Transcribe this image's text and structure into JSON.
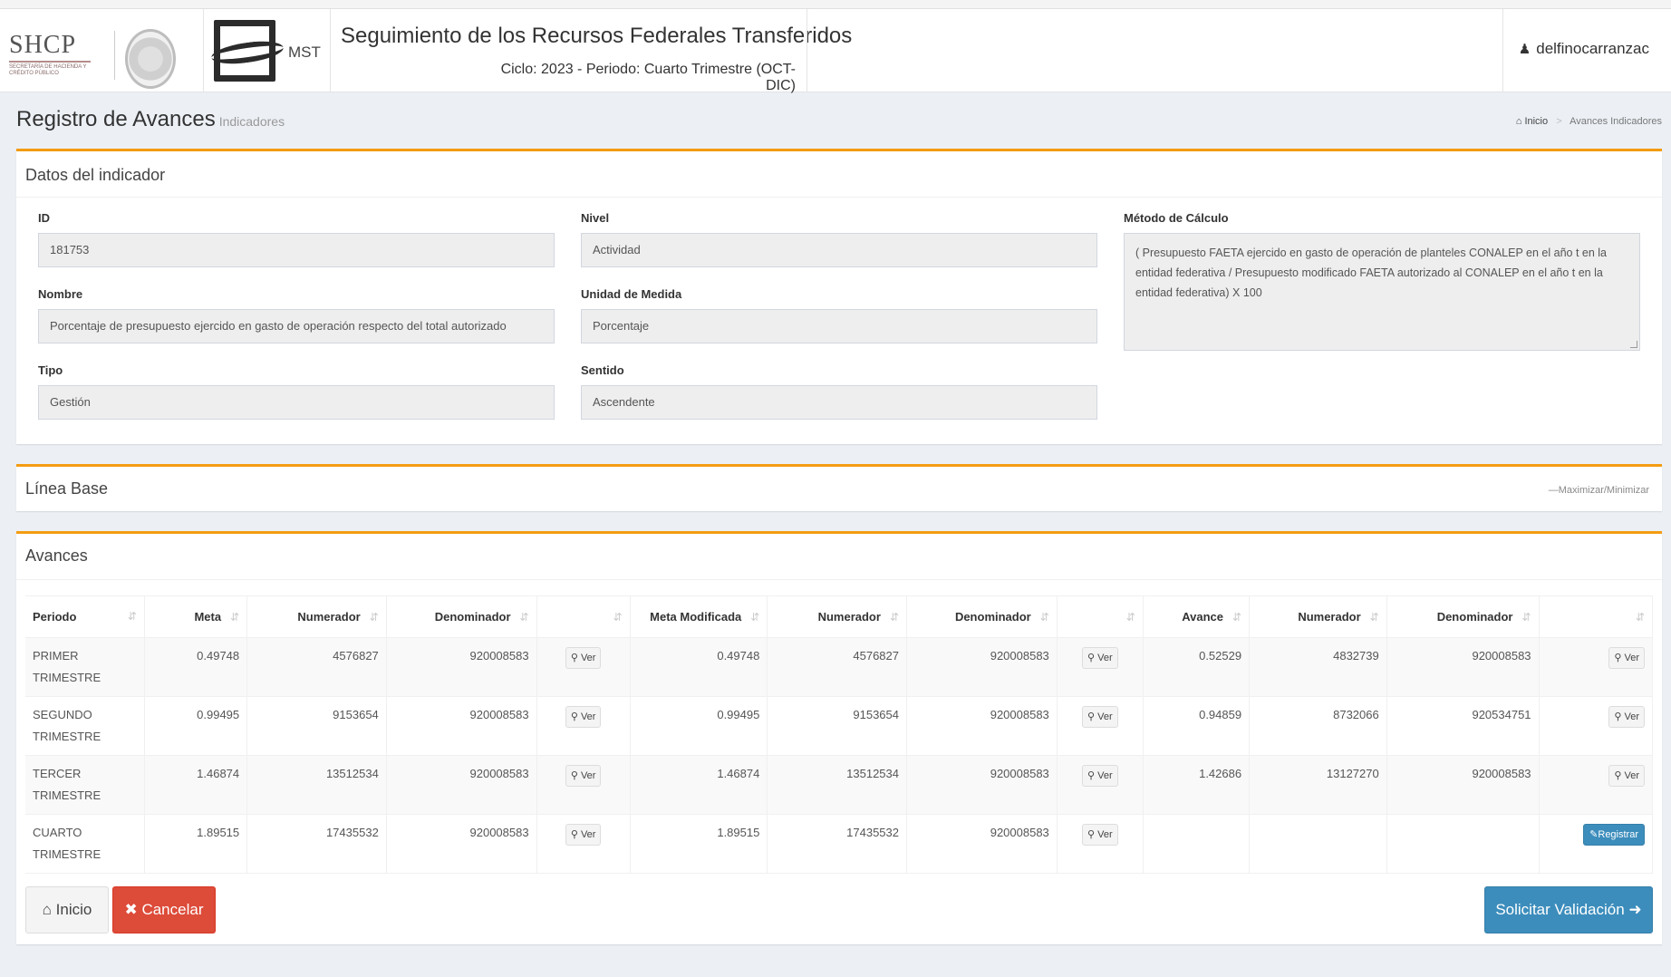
{
  "header": {
    "shcp_logo_text": "SHCP",
    "shcp_logo_sub": "SECRETARÍA DE HACIENDA Y CRÉDITO PÚBLICO",
    "mst_text": "MST",
    "title": "Seguimiento de los Recursos Federales Transferidos",
    "subtitle": "Ciclo: 2023 - Periodo: Cuarto Trimestre (OCT-DIC)",
    "user": "delfinocarranzac"
  },
  "page": {
    "title": "Registro de Avances",
    "subtitle": "Indicadores",
    "breadcrumb": {
      "home": "Inicio",
      "current": "Avances Indicadores"
    }
  },
  "datos": {
    "title": "Datos del indicador",
    "id_label": "ID",
    "id_value": "181753",
    "nivel_label": "Nivel",
    "nivel_value": "Actividad",
    "metodo_label": "Método de Cálculo",
    "metodo_value": "( Presupuesto FAETA ejercido en gasto de operación de planteles CONALEP en el año t en la entidad federativa / Presupuesto modificado FAETA autorizado al CONALEP en el año t en la entidad federativa) X 100",
    "nombre_label": "Nombre",
    "nombre_value": "Porcentaje de presupuesto ejercido en gasto de operación respecto del total autorizado",
    "unidad_label": "Unidad de Medida",
    "unidad_value": "Porcentaje",
    "tipo_label": "Tipo",
    "tipo_value": "Gestión",
    "sentido_label": "Sentido",
    "sentido_value": "Ascendente"
  },
  "linea_base": {
    "title": "Línea Base",
    "toggle": "Maximizar/Minimizar"
  },
  "avances": {
    "title": "Avances",
    "columns": [
      "Periodo",
      "Meta",
      "Numerador",
      "Denominador",
      "",
      "Meta Modificada",
      "Numerador",
      "Denominador",
      "",
      "Avance",
      "Numerador",
      "Denominador",
      ""
    ],
    "ver_label": "Ver",
    "registrar_label": "Registrar",
    "rows": [
      {
        "periodo": "PRIMER TRIMESTRE",
        "meta": "0.49748",
        "num": "4576827",
        "den": "920008583",
        "meta_mod": "0.49748",
        "num_mod": "4576827",
        "den_mod": "920008583",
        "avance": "0.52529",
        "num_av": "4832739",
        "den_av": "920008583"
      },
      {
        "periodo": "SEGUNDO TRIMESTRE",
        "meta": "0.99495",
        "num": "9153654",
        "den": "920008583",
        "meta_mod": "0.99495",
        "num_mod": "9153654",
        "den_mod": "920008583",
        "avance": "0.94859",
        "num_av": "8732066",
        "den_av": "920534751"
      },
      {
        "periodo": "TERCER TRIMESTRE",
        "meta": "1.46874",
        "num": "13512534",
        "den": "920008583",
        "meta_mod": "1.46874",
        "num_mod": "13512534",
        "den_mod": "920008583",
        "avance": "1.42686",
        "num_av": "13127270",
        "den_av": "920008583"
      },
      {
        "periodo": "CUARTO TRIMESTRE",
        "meta": "1.89515",
        "num": "17435532",
        "den": "920008583",
        "meta_mod": "1.89515",
        "num_mod": "17435532",
        "den_mod": "920008583",
        "avance": "",
        "num_av": "",
        "den_av": ""
      }
    ]
  },
  "footer": {
    "inicio": "Inicio",
    "cancelar": "Cancelar",
    "solicitar": "Solicitar Validación"
  },
  "colors": {
    "accent": "#f39c12",
    "primary": "#3c8dbc",
    "danger": "#dd4b39"
  },
  "icons": {
    "user": "user-icon",
    "home": "home-icon",
    "search": "search-icon",
    "close": "close-icon",
    "arrow": "arrow-right-icon",
    "pencil": "pencil-icon"
  }
}
